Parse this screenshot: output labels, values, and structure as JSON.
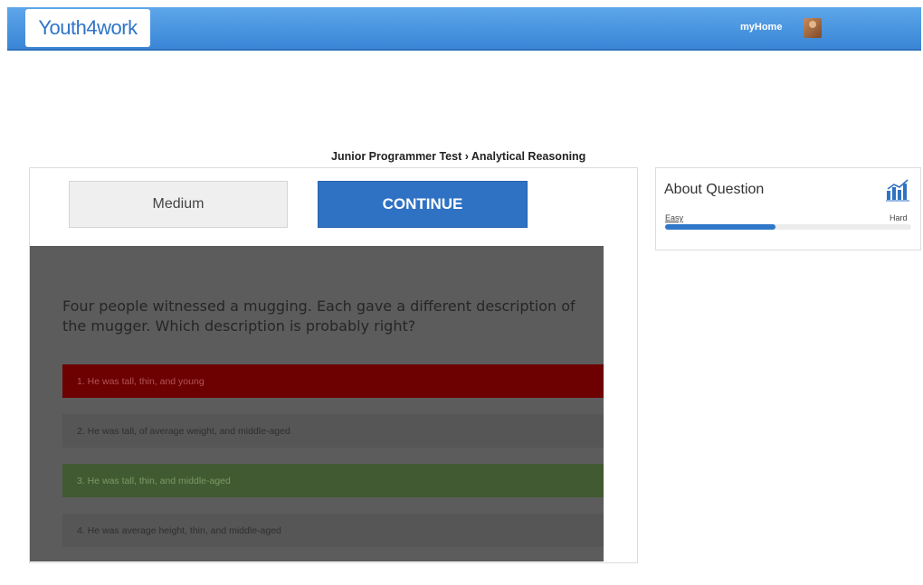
{
  "header": {
    "logo_text": "Youth4work",
    "myhome_label": "myHome",
    "avatar_icon": "user-avatar"
  },
  "breadcrumb": {
    "text": "Junior Programmer Test › Analytical Reasoning"
  },
  "toolbar": {
    "difficulty_label": "Medium",
    "continue_label": "CONTINUE"
  },
  "question": {
    "text": "Four people witnessed a mugging. Each gave a different description of the mugger. Which description is probably right?",
    "options": [
      {
        "label": "1. He was tall, thin, and young",
        "state": "wrong"
      },
      {
        "label": "2. He was tall, of average weight, and middle-aged",
        "state": "neutral"
      },
      {
        "label": "3. He was tall, thin, and middle-aged",
        "state": "correct"
      },
      {
        "label": "4. He was average height, thin, and middle-aged",
        "state": "neutral"
      }
    ]
  },
  "about": {
    "title": "About Question",
    "icon": "bar-chart-icon",
    "easy_label": "Easy",
    "hard_label": "Hard",
    "difficulty_fraction": 0.45
  },
  "colors": {
    "header_blue": "#3a86d6",
    "continue_blue": "#2f72c4",
    "wrong_red": "#6d0000",
    "correct_green": "#415a31"
  }
}
